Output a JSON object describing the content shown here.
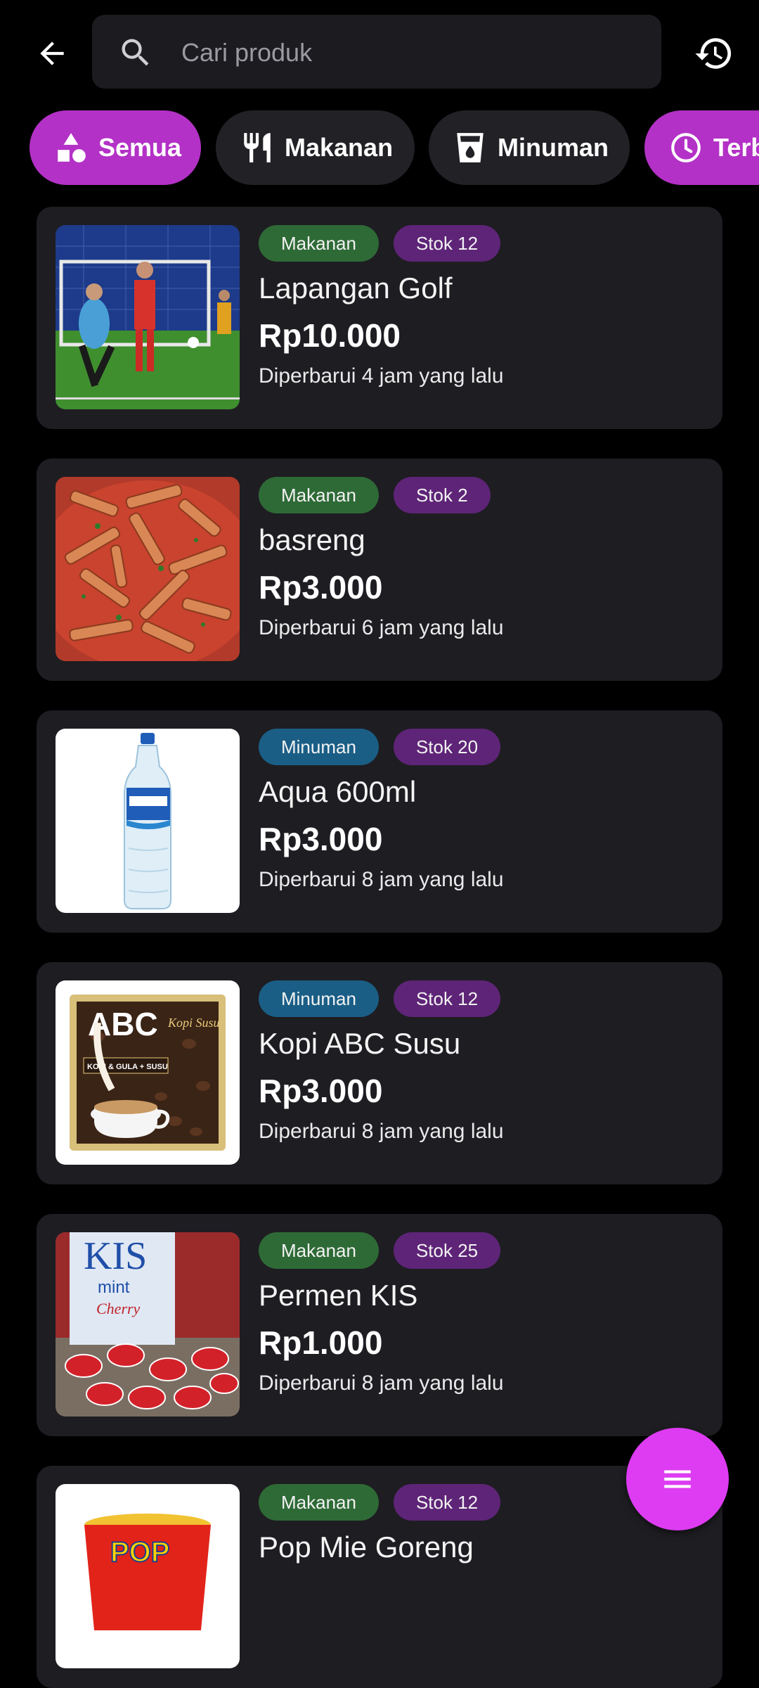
{
  "search": {
    "placeholder": "Cari produk"
  },
  "icons": {
    "back": "arrow-left-icon",
    "search": "search-icon",
    "history": "history-icon",
    "fab": "menu-icon"
  },
  "colors": {
    "accent": "#b331c6",
    "fab": "#dd3cf3",
    "makanan_badge": "#2e6a36",
    "minuman_badge": "#1a5e86",
    "stok_badge": "#5e2477",
    "card": "#1e1d22"
  },
  "filters": [
    {
      "label": "Semua",
      "icon": "shapes-icon",
      "active": true
    },
    {
      "label": "Makanan",
      "icon": "utensils-icon",
      "active": false
    },
    {
      "label": "Minuman",
      "icon": "cup-icon",
      "active": false
    },
    {
      "label": "Terbaru",
      "icon": "clock-icon",
      "active": true
    }
  ],
  "products": [
    {
      "category": "Makanan",
      "stock": "Stok 12",
      "name": "Lapangan Golf",
      "price": "Rp10.000",
      "updated": "Diperbarui 4 jam yang lalu"
    },
    {
      "category": "Makanan",
      "stock": "Stok 2",
      "name": "basreng",
      "price": "Rp3.000",
      "updated": "Diperbarui 6 jam yang lalu"
    },
    {
      "category": "Minuman",
      "stock": "Stok 20",
      "name": "Aqua 600ml",
      "price": "Rp3.000",
      "updated": "Diperbarui 8 jam yang lalu"
    },
    {
      "category": "Minuman",
      "stock": "Stok 12",
      "name": "Kopi ABC Susu",
      "price": "Rp3.000",
      "updated": "Diperbarui 8 jam yang lalu"
    },
    {
      "category": "Makanan",
      "stock": "Stok 25",
      "name": "Permen KIS",
      "price": "Rp1.000",
      "updated": "Diperbarui 8 jam yang lalu"
    },
    {
      "category": "Makanan",
      "stock": "Stok 12",
      "name": "Pop Mie Goreng",
      "price": "",
      "updated": ""
    }
  ],
  "image_text": {
    "abc_brand": "ABC",
    "abc_sub": "Kopi Susu",
    "abc_band": "KOPI & GULA + SUSU",
    "kis_brand": "KIS",
    "kis_sub": "mint",
    "kis_flavor": "Cherry",
    "pop_brand": "POP"
  }
}
